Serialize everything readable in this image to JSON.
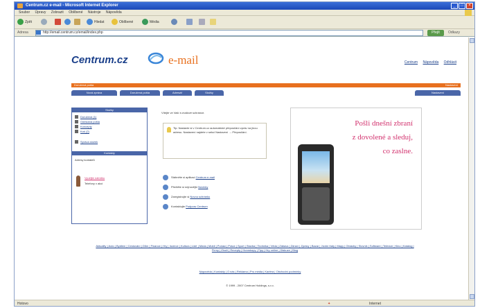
{
  "window": {
    "title": "Centrum.cz e-mail - Microsoft Internet Explorer"
  },
  "menu": [
    "Soubor",
    "Úpravy",
    "Zobrazit",
    "Oblíbené",
    "Nástroje",
    "Nápověda"
  ],
  "toolbar": {
    "back": "Zpět",
    "search": "Hledat",
    "favorites": "Oblíbené",
    "media": "Média"
  },
  "address": {
    "label": "Adresa",
    "url": "http://email.centrum.cz/email/index.php",
    "go": "Přejít",
    "links": "Odkazy"
  },
  "page": {
    "logo_main": "Centrum.cz",
    "logo_email": "e-mail",
    "top_links": [
      "Centrum",
      "Nápověda",
      "Odhlásit"
    ],
    "orange_left": "Doručená pošta",
    "orange_right": "Nastavení",
    "tabs": [
      "Nová zpráva",
      "Doručená pošta",
      "Adresář",
      "Složky",
      "Nastavení"
    ],
    "left_panel": {
      "head1": "Složky",
      "items": [
        "Doručená (1)",
        "Odeslaná pošta",
        "Koncepty",
        "Koš (2)",
        "Správa složek"
      ],
      "head2": "Kontakty",
      "contacts_label": "Adresy kontaktů",
      "promo_link": "Využijte nabídku",
      "promo_text": "Telefony v akci"
    },
    "intro": "Vítejte ve Vaší e-mailové schránce.",
    "tip": "Tip: Nastavte si v Centrum.cz automatické přeposílání zpráv na jinou adresu. Nastavení najdete v sekci Nastavení → Přeposílání.",
    "actions": [
      {
        "text": "Stáhněte si aplikaci",
        "link": "Centrum e-mail"
      },
      {
        "text": "Přečtěte si nejnovější",
        "link": "Novinky"
      },
      {
        "text": "Zaregistrujte si",
        "link": "Novou schránku"
      },
      {
        "text": "Kontaktujte",
        "link": "Podporu Centrum"
      }
    ],
    "ad": {
      "line1": "Pošli dnešní zbraní",
      "line2": "z dovolené a sleduj,",
      "line3": "co zaslne."
    },
    "footer_links": "Aktuality | Auto | Bydlení | Cestování | Dům | Finance | Hry | Inzerce | Kultura | Lidé | Móda | Mobil | Počasí | Práce | Sport | Stavba | Technika | Věda | Zábava | Zdraví | Zprávy | Bazar | Jízdní řády | Mapy | Obrázky | Slovník | Software | Televize | Kino | Katalog | Firmy | Zboží | Recepty | Horoskopy | Tipy | Hry online | Diskuze | Blog",
    "footer_links2": "Nápověda | Kontakty | O nás | Reklama | Pro média | Kariéra | Obchodní podmínky",
    "copyright": "© 1999 - 2007 Centrum Holdings, s.r.o."
  },
  "status": {
    "text": "Hotovo",
    "zone": "Internet"
  }
}
